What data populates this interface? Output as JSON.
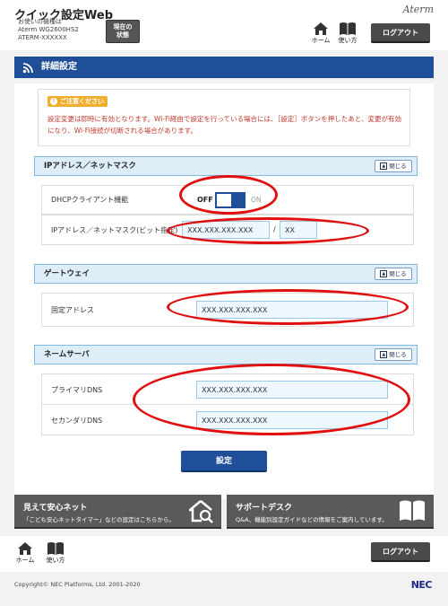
{
  "header": {
    "app_title": "クイック設定Web",
    "device_caption": "お使いの機種は",
    "device_model": "Aterm WG2600HS2",
    "device_serial": "ATERM-XXXXXX",
    "status_label_1": "現在の",
    "status_label_2": "状態",
    "brand": "Aterm",
    "home_label": "ホーム",
    "help_label": "使い方",
    "logout_label": "ログアウト"
  },
  "section": {
    "title": "詳細設定"
  },
  "notice": {
    "badge": "ご注意ください",
    "text": "設定変更は即時に有効となります。Wi-Fi経由で設定を行っている場合には、［設定］ボタンを押したあと、変更が有効になり、Wi-Fi接続が切断される場合があります。"
  },
  "ip_group": {
    "title": "IPアドレス／ネットマスク",
    "close_label": "閉じる",
    "dhcp_label": "DHCPクライアント機能",
    "toggle_off": "OFF",
    "toggle_on": "ON",
    "toggle_state": "off",
    "ip_label": "IPアドレス／ネットマスク(ビット指定)",
    "ip_value": "XXX.XXX.XXX.XXX",
    "separator": "/",
    "mask_value": "XX"
  },
  "gateway_group": {
    "title": "ゲートウェイ",
    "close_label": "閉じる",
    "fixed_label": "固定アドレス",
    "fixed_value": "XXX.XXX.XXX.XXX"
  },
  "dns_group": {
    "title": "ネームサーバ",
    "close_label": "閉じる",
    "primary_label": "プライマリDNS",
    "primary_value": "XXX.XXX.XXX.XXX",
    "secondary_label": "セカンダリDNS",
    "secondary_value": "XXX.XXX.XXX.XXX"
  },
  "submit_label": "設定",
  "banners": {
    "left_title": "見えて安心ネット",
    "left_desc": "「こども安心ネットタイマー」などの設定はこちらから。",
    "right_title": "サポートデスク",
    "right_desc": "Q&A、機能別設定ガイドなどの情報をご案内しています。"
  },
  "footer": {
    "home_label": "ホーム",
    "help_label": "使い方",
    "logout_label": "ログアウト",
    "copyright": "Copyright© NEC Platforms, Ltd. 2001-2020",
    "nec_logo": "NEC"
  },
  "colors": {
    "accent": "#1f4f98",
    "highlight_ring": "#e01010",
    "notice_text": "#c0392b"
  }
}
